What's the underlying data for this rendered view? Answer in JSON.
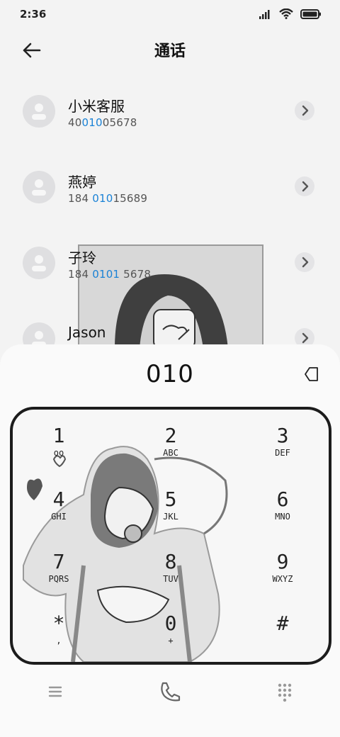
{
  "status_bar": {
    "time": "2:36",
    "icons": [
      "signal-icon",
      "wifi-icon",
      "battery-icon"
    ]
  },
  "header": {
    "title": "通话",
    "back_icon": "arrow-left-icon"
  },
  "contacts": [
    {
      "name": "小米客服",
      "number_parts": [
        "40",
        "010",
        "05678"
      ]
    },
    {
      "name": "燕婷",
      "number_parts": [
        "184 ",
        "010",
        "15689"
      ]
    },
    {
      "name": "子玲",
      "number_parts": [
        "184 ",
        "0101",
        " 5678"
      ]
    },
    {
      "name": "Jason",
      "number_parts": [
        "",
        "",
        ""
      ]
    }
  ],
  "dialer": {
    "input": "010",
    "keys": [
      {
        "digit": "1",
        "letters": "oo"
      },
      {
        "digit": "2",
        "letters": "ABC"
      },
      {
        "digit": "3",
        "letters": "DEF"
      },
      {
        "digit": "4",
        "letters": "GHI"
      },
      {
        "digit": "5",
        "letters": "JKL"
      },
      {
        "digit": "6",
        "letters": "MNO"
      },
      {
        "digit": "7",
        "letters": "PQRS"
      },
      {
        "digit": "8",
        "letters": "TUV"
      },
      {
        "digit": "9",
        "letters": "WXYZ"
      },
      {
        "digit": "*",
        "letters": ","
      },
      {
        "digit": "0",
        "letters": "+"
      },
      {
        "digit": "#",
        "letters": ""
      }
    ]
  },
  "bottom_nav": [
    "menu-icon",
    "phone-icon",
    "keypad-grid-icon"
  ],
  "accent_color": "#1a82d6"
}
